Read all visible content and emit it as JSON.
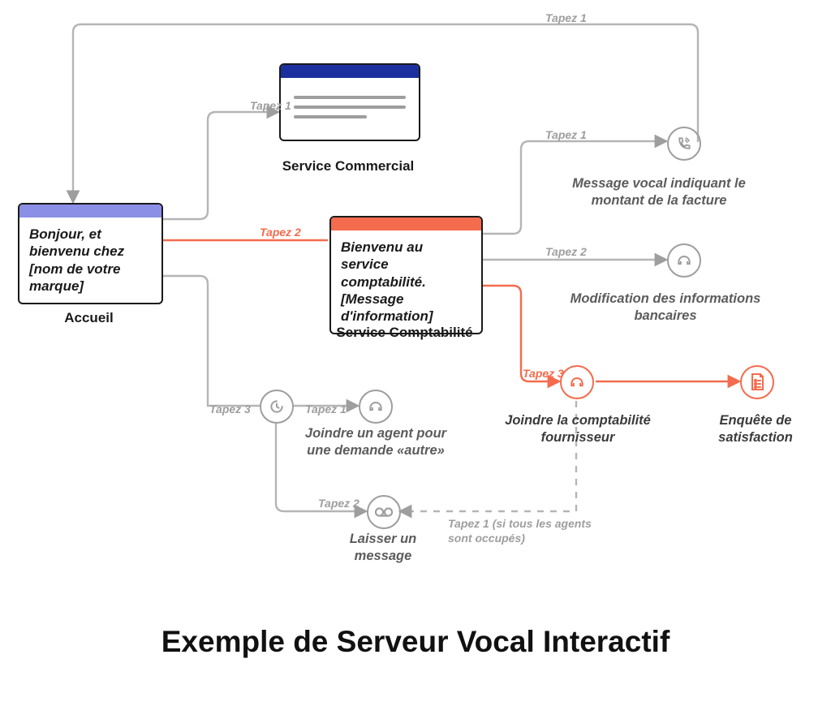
{
  "title": "Exemple de Serveur Vocal Interactif",
  "cards": {
    "accueil": {
      "label": "Accueil",
      "text": "Bonjour, et bienvenu chez [nom de votre marque]"
    },
    "commercial": {
      "label": "Service Commercial"
    },
    "comptabilite": {
      "label": "Service Comptabilité",
      "text": "Bienvenu au service comptabilité. [Message d'information]"
    }
  },
  "edges": {
    "a_to_commercial": "Tapez 1",
    "a_to_compta": "Tapez 2",
    "a_to_other": "Tapez 3",
    "other_to_agent": "Tapez 1",
    "other_to_message": "Tapez 2",
    "compta_to_voice": "Tapez 1",
    "compta_to_bank": "Tapez 2",
    "compta_to_fournisseur": "Tapez 3",
    "loop_back": "Tapez 1",
    "busy": "Tapez 1 (si tous les agents sont occupés)"
  },
  "leaves": {
    "voice": "Message vocal indiquant le montant de la facture",
    "bank": "Modification des informations bancaires",
    "fournisseur": "Joindre la comptabilité fournisseur",
    "satisfaction": "Enquête de satisfaction",
    "agent": "Joindre un agent pour une demande «autre»",
    "laisser": "Laisser un message"
  }
}
